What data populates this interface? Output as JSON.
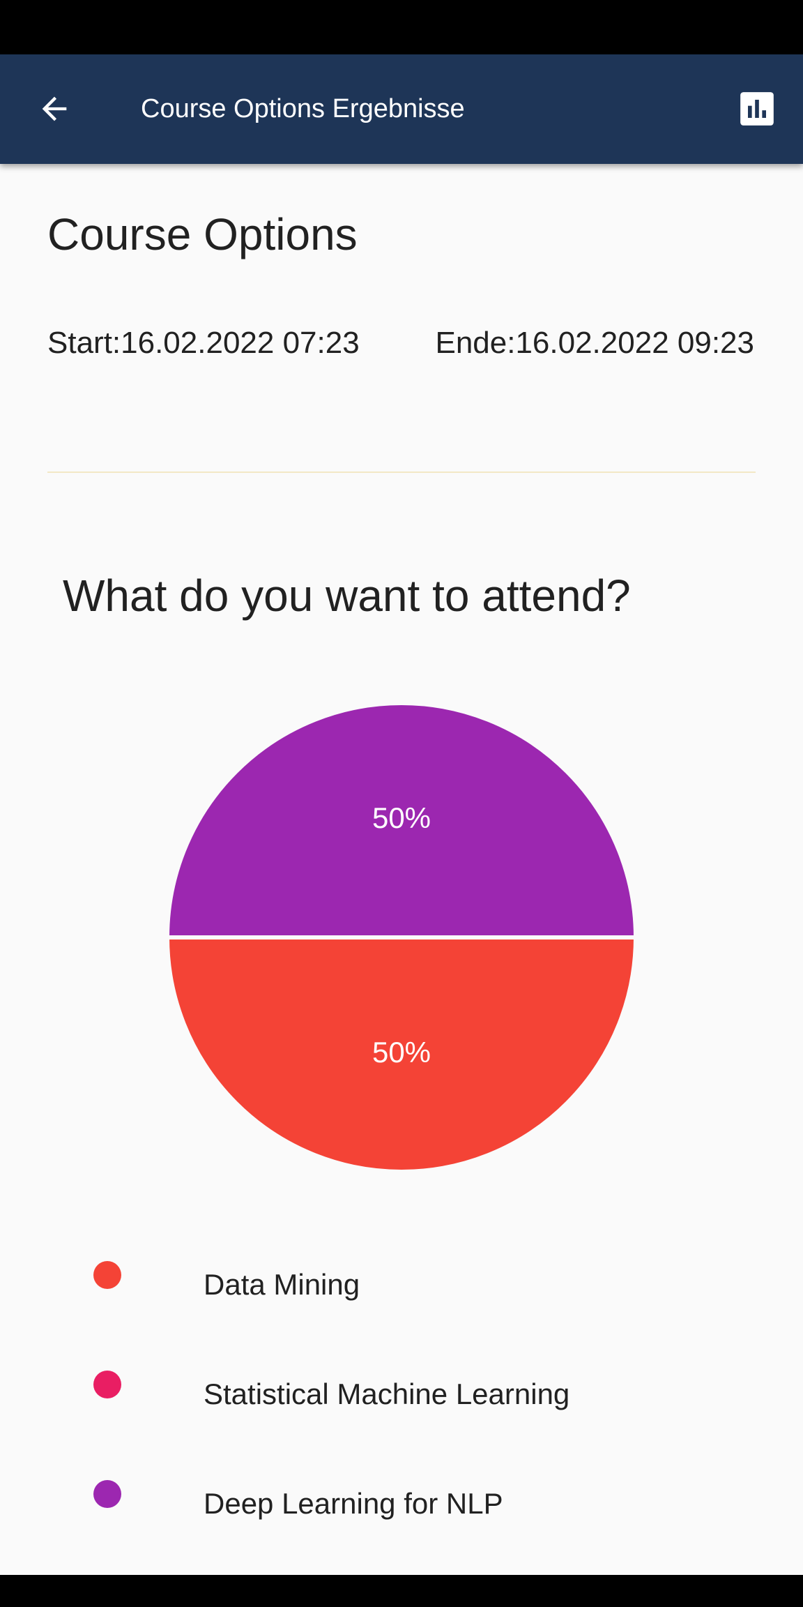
{
  "app_bar": {
    "title": "Course Options Ergebnisse",
    "back_icon": "arrow-left-icon",
    "chart_icon": "bar-chart-icon",
    "background_color": "#1e3557"
  },
  "poll": {
    "title": "Course Options",
    "start": "Start:16.02.2022 07:23",
    "end": "Ende:16.02.2022 09:23"
  },
  "question": {
    "text": "What do you want to attend?"
  },
  "chart_data": {
    "type": "pie",
    "slices": [
      {
        "label": "Data Mining",
        "value": 50,
        "display": "50%",
        "color": "#f44336"
      },
      {
        "label": "Statistical Machine Learning",
        "value": 0,
        "display": "",
        "color": "#e91e63"
      },
      {
        "label": "Deep Learning for NLP",
        "value": 50,
        "display": "50%",
        "color": "#9c27b0"
      }
    ],
    "legend_position": "bottom"
  }
}
